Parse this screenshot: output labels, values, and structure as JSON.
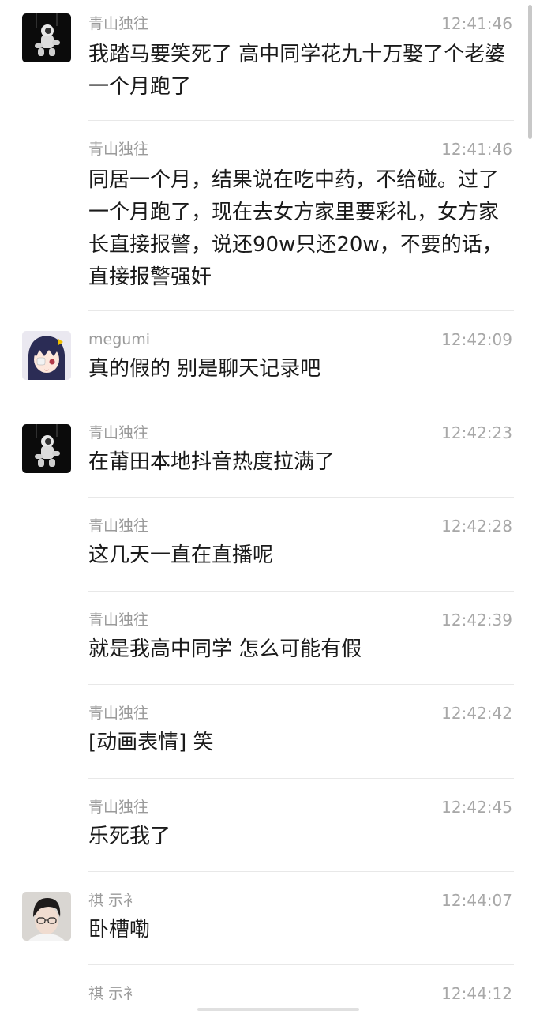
{
  "messages": [
    {
      "sender": "青山独往",
      "time": "12:41:46",
      "text": "我踏马要笑死了 高中同学花九十万娶了个老婆 一个月跑了",
      "avatar": "astronaut-avatar"
    },
    {
      "sender": "青山独往",
      "time": "12:41:46",
      "text": "同居一个月，结果说在吃中药，不给碰。过了一个月跑了，现在去女方家里要彩礼，女方家长直接报警，说还90w只还20w，不要的话，直接报警强奸",
      "avatar": ""
    },
    {
      "sender": "megumi",
      "time": "12:42:09",
      "text": "真的假的  别是聊天记录吧",
      "avatar": "anime-girl-avatar"
    },
    {
      "sender": "青山独往",
      "time": "12:42:23",
      "text": "在莆田本地抖音热度拉满了",
      "avatar": "astronaut-avatar"
    },
    {
      "sender": "青山独往",
      "time": "12:42:28",
      "text": "这几天一直在直播呢",
      "avatar": ""
    },
    {
      "sender": "青山独往",
      "time": "12:42:39",
      "text": "就是我高中同学 怎么可能有假",
      "avatar": ""
    },
    {
      "sender": "青山独往",
      "time": "12:42:42",
      "text": "[动画表情] 笑",
      "avatar": ""
    },
    {
      "sender": "青山独往",
      "time": "12:42:45",
      "text": "乐死我了",
      "avatar": ""
    },
    {
      "sender": "祺 示衤",
      "time": "12:44:07",
      "text": "卧槽嘞",
      "avatar": "young-man-avatar"
    },
    {
      "sender": "祺 示衤",
      "time": "12:44:12",
      "text": "",
      "avatar": ""
    }
  ]
}
